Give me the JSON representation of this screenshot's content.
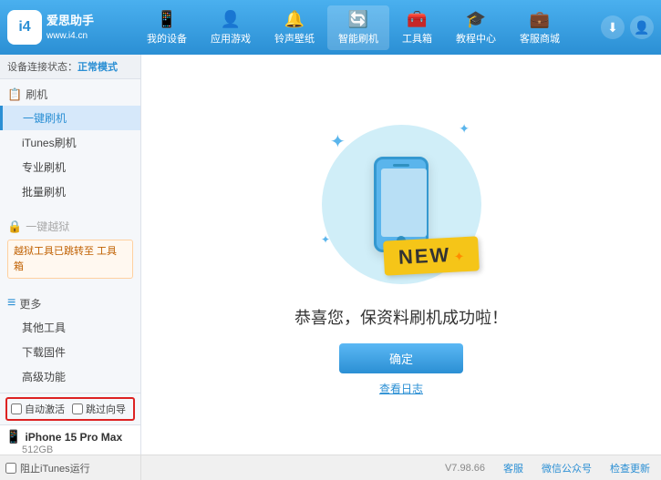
{
  "header": {
    "logo_text1": "爱思助手",
    "logo_text2": "www.i4.cn",
    "logo_abbr": "i4",
    "nav": [
      {
        "id": "my-device",
        "icon": "📱",
        "label": "我的设备"
      },
      {
        "id": "app-games",
        "icon": "👤",
        "label": "应用游戏"
      },
      {
        "id": "ringtone",
        "icon": "🔔",
        "label": "铃声壁纸"
      },
      {
        "id": "smart-flash",
        "icon": "🔄",
        "label": "智能刷机",
        "active": true
      },
      {
        "id": "tools",
        "icon": "🧰",
        "label": "工具箱"
      },
      {
        "id": "tutorials",
        "icon": "🎓",
        "label": "教程中心"
      },
      {
        "id": "service",
        "icon": "💼",
        "label": "客服商城"
      }
    ]
  },
  "sidebar": {
    "status_label": "设备连接状态：",
    "status_value": "正常模式",
    "sections": [
      {
        "header": "刷机",
        "icon": "📋",
        "items": [
          {
            "label": "一键刷机",
            "active": true
          },
          {
            "label": "iTunes刷机"
          },
          {
            "label": "专业刷机"
          },
          {
            "label": "批量刷机"
          }
        ]
      },
      {
        "header": "一键越狱",
        "disabled": true,
        "warning": "越狱工具已跳转至\n工具箱"
      },
      {
        "header": "更多",
        "icon": "≡",
        "items": [
          {
            "label": "其他工具"
          },
          {
            "label": "下载固件"
          },
          {
            "label": "高级功能"
          }
        ]
      }
    ],
    "checkbox_auto": "自动激活",
    "checkbox_guide": "跳过向导",
    "device_name": "iPhone 15 Pro Max",
    "device_storage": "512GB",
    "device_type": "iPhone",
    "stop_itunes": "阻止iTunes运行"
  },
  "content": {
    "success_message": "恭喜您，保资料刷机成功啦！",
    "confirm_button": "确定",
    "view_log": "查看日志"
  },
  "footer": {
    "version": "V7.98.66",
    "links": [
      "客服",
      "微信公众号",
      "检查更新"
    ]
  }
}
